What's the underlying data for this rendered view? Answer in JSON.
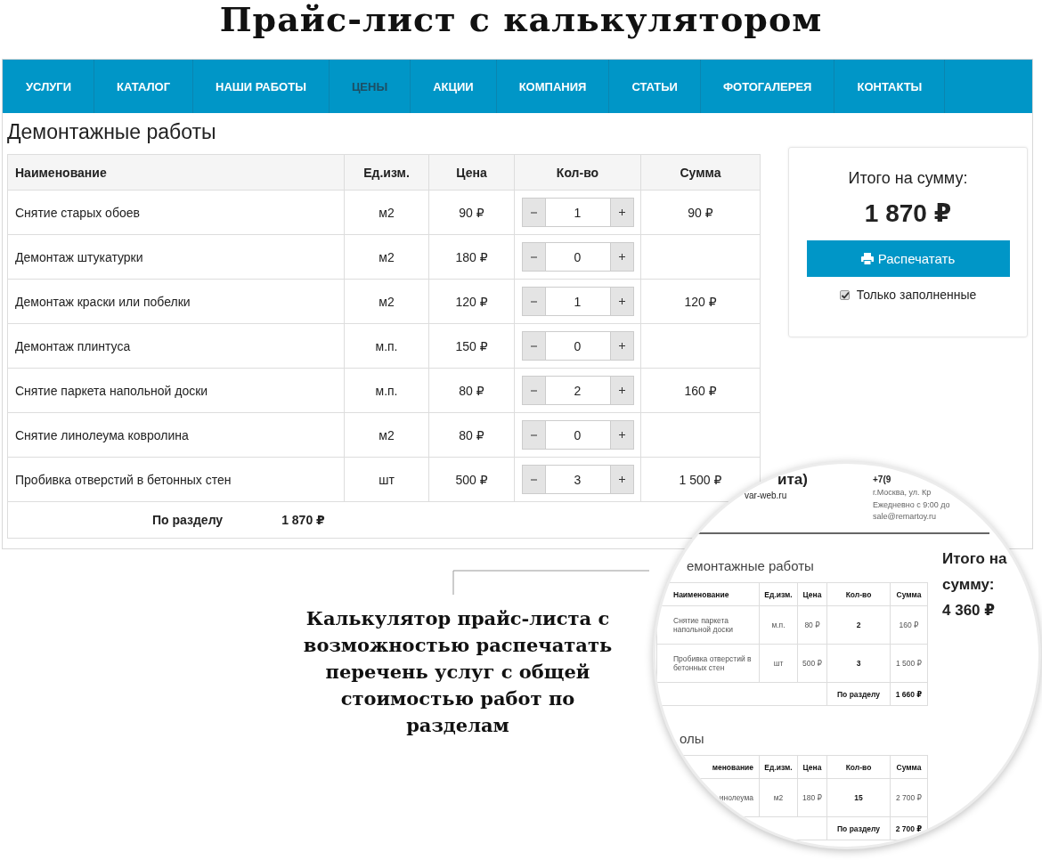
{
  "page_title": "Прайс-лист с калькулятором",
  "nav": [
    {
      "label": "УСЛУГИ",
      "selected": false
    },
    {
      "label": "КАТАЛОГ",
      "selected": false
    },
    {
      "label": "НАШИ РАБОТЫ",
      "selected": false
    },
    {
      "label": "ЦЕНЫ",
      "selected": true
    },
    {
      "label": "АКЦИИ",
      "selected": false
    },
    {
      "label": "КОМПАНИЯ",
      "selected": false
    },
    {
      "label": "СТАТЬИ",
      "selected": false
    },
    {
      "label": "ФОТОГАЛЕРЕЯ",
      "selected": false
    },
    {
      "label": "КОНТАКТЫ",
      "selected": false
    }
  ],
  "section": {
    "title": "Демонтажные работы",
    "columns": [
      "Наименование",
      "Ед.изм.",
      "Цена",
      "Кол-во",
      "Сумма"
    ],
    "rows": [
      {
        "name": "Снятие старых обоев",
        "unit": "м2",
        "price": "90 ₽",
        "qty": "1",
        "sum": "90 ₽"
      },
      {
        "name": "Демонтаж штукатурки",
        "unit": "м2",
        "price": "180 ₽",
        "qty": "0"
      },
      {
        "name": "Демонтаж краски или побелки",
        "unit": "м2",
        "price": "120 ₽",
        "qty": "1",
        "sum": "120 ₽"
      },
      {
        "name": "Демонтаж плинтуса",
        "unit": "м.п.",
        "price": "150 ₽",
        "qty": "0"
      },
      {
        "name": "Снятие паркета напольной доски",
        "unit": "м.п.",
        "price": "80 ₽",
        "qty": "2",
        "sum": "160 ₽"
      },
      {
        "name": "Снятие линолеума ковролина",
        "unit": "м2",
        "price": "80 ₽",
        "qty": "0"
      },
      {
        "name": "Пробивка отверстий в бетонных стен",
        "unit": "шт",
        "price": "500 ₽",
        "qty": "3",
        "sum": "1 500 ₽"
      }
    ],
    "footer_label": "По разделу",
    "footer_total": "1 870 ₽"
  },
  "summary": {
    "label": "Итого на сумму:",
    "total": "1 870 ₽",
    "print_button": "Распечатать",
    "only_filled": {
      "label": "Только заполненные",
      "checked": true
    }
  },
  "caption": [
    "Калькулятор прайс-листа с",
    "возможностью распечатать",
    "перечень услуг с общей",
    "стоимостью работ по",
    "разделам"
  ],
  "magnifier": {
    "header_title": "ита)",
    "header_site": "var-web.ru",
    "phone": "+7(9",
    "address_lines": [
      "г.Москва, ул. Кр",
      "Ежедневно с 9:00 до",
      "sale@remartoy.ru"
    ],
    "total_label": [
      "Итого на",
      "сумму:"
    ],
    "total": "4 360 ₽",
    "sections": [
      {
        "title": "емонтажные работы",
        "columns": [
          "Наименование",
          "Ед.изм.",
          "Цена",
          "Кол-во",
          "Сумма"
        ],
        "rows": [
          {
            "name": "Снятие паркета напольной доски",
            "unit": "м.п.",
            "price": "80 ₽",
            "qty": "2",
            "sum": "160 ₽"
          },
          {
            "name": "Пробивка отверстий в бетонных стен",
            "unit": "шт",
            "price": "500 ₽",
            "qty": "3",
            "sum": "1 500 ₽"
          }
        ],
        "footer_label": "По разделу",
        "footer_total": "1 660 ₽"
      },
      {
        "title": "олы",
        "columns": [
          "менование",
          "Ед.изм.",
          "Цена",
          "Кол-во",
          "Сумма"
        ],
        "rows": [
          {
            "name": "инолеума",
            "unit": "м2",
            "price": "180 ₽",
            "qty": "15",
            "sum": "2 700 ₽"
          }
        ],
        "footer_label": "По разделу",
        "footer_total": "2 700 ₽"
      }
    ]
  }
}
